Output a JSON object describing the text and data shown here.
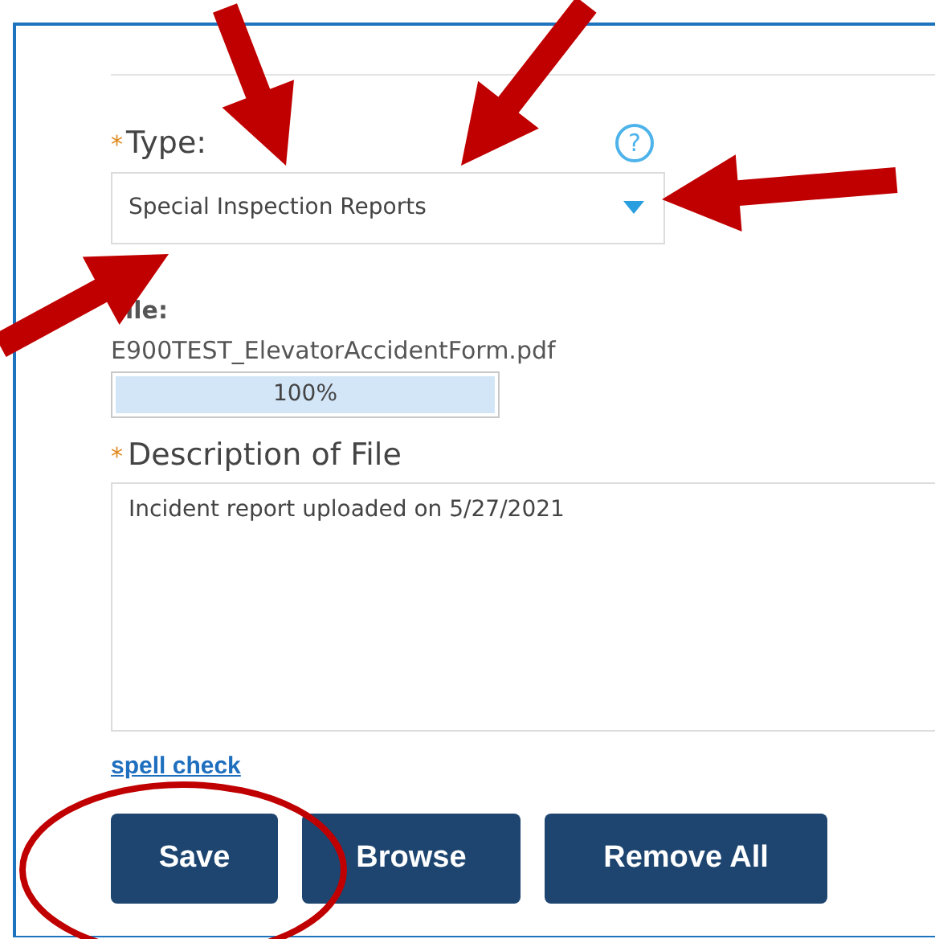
{
  "type_field": {
    "required_mark": "*",
    "label": "Type:",
    "help": "?",
    "value": "Special Inspection Reports"
  },
  "file": {
    "label": "ile:",
    "name": "E900TEST_ElevatorAccidentForm.pdf",
    "level": 1,
    "progress_text": "100%"
  },
  "description": {
    "required_mark": "*",
    "label": "Description of File",
    "value": "Incident report uploaded on 5/27/2021"
  },
  "spell_check_link": "spell check",
  "buttons": [
    "Save",
    "Browse",
    "Remove All"
  ]
}
